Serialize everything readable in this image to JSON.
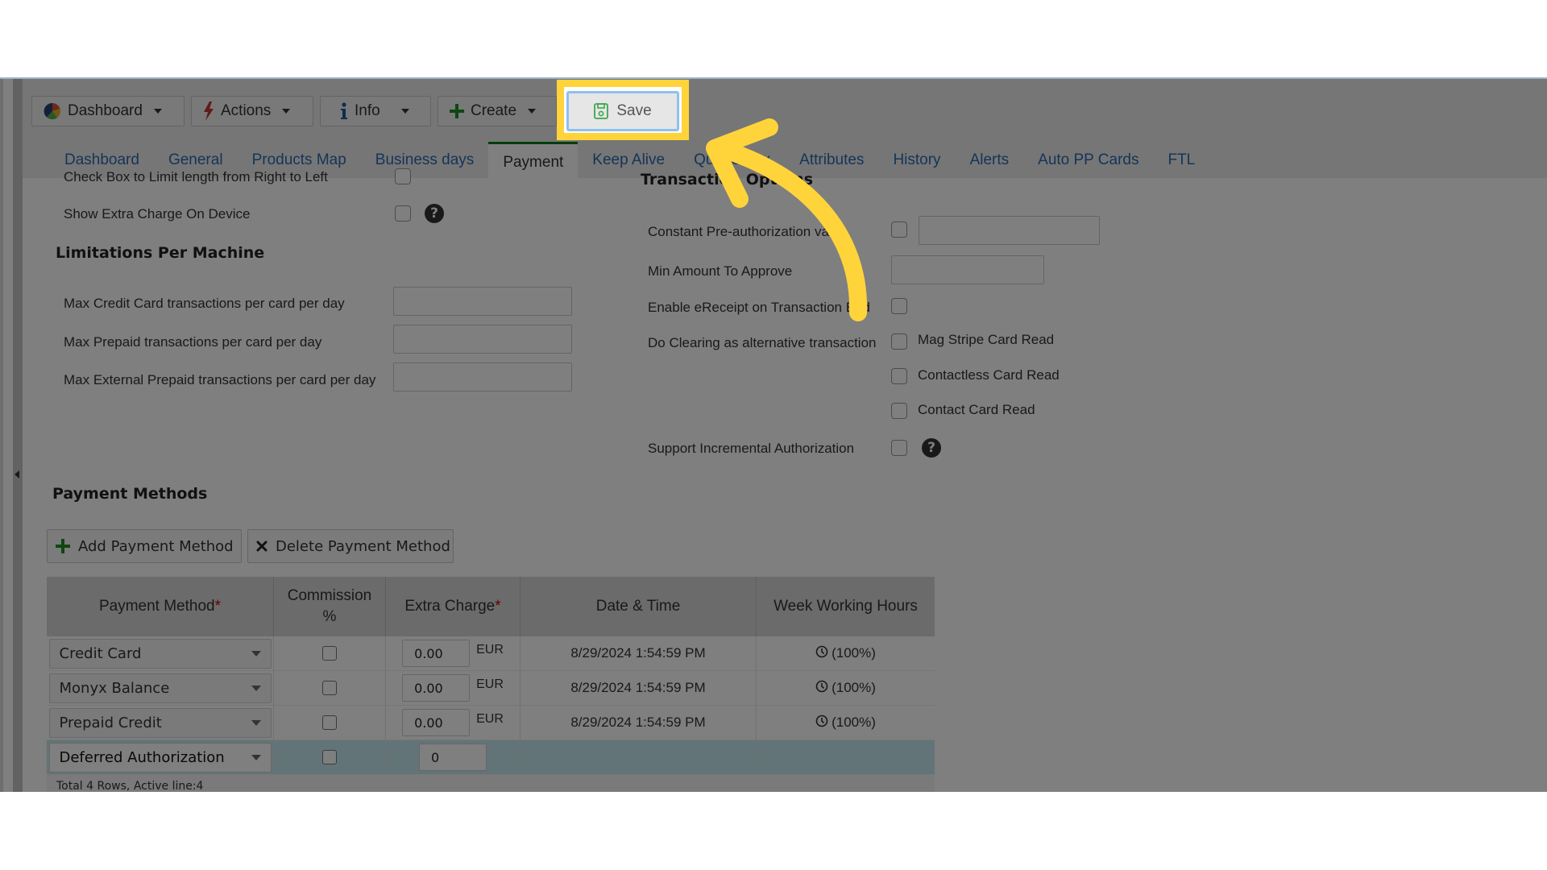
{
  "toolbar": {
    "buttons": [
      {
        "label": "Dashboard",
        "icon": "pie-chart-icon"
      },
      {
        "label": "Actions",
        "icon": "lightning-icon"
      },
      {
        "label": "Info",
        "icon": "info-icon"
      },
      {
        "label": "Create",
        "icon": "plus-icon"
      }
    ],
    "save": {
      "label": "Save",
      "icon": "floppy-disk-icon"
    }
  },
  "tabs": [
    {
      "label": "Dashboard",
      "active": false
    },
    {
      "label": "General",
      "active": false
    },
    {
      "label": "Products Map",
      "active": false
    },
    {
      "label": "Business days",
      "active": false
    },
    {
      "label": "Payment",
      "active": true
    },
    {
      "label": "Keep Alive",
      "active": false
    },
    {
      "label": "Queue Box",
      "active": false
    },
    {
      "label": "Attributes",
      "active": false
    },
    {
      "label": "History",
      "active": false
    },
    {
      "label": "Alerts",
      "active": false
    },
    {
      "label": "Auto PP Cards",
      "active": false
    },
    {
      "label": "FTL",
      "active": false
    }
  ],
  "left_form": {
    "limit_rtl_label": "Check Box to Limit length from Right to Left",
    "show_extra_charge_label": "Show Extra Charge On Device",
    "limitations_title": "Limitations Per Machine",
    "max_credit_label": "Max Credit Card transactions per card per day",
    "max_credit_value": "",
    "max_prepaid_label": "Max Prepaid transactions per card per day",
    "max_prepaid_value": "",
    "max_ext_prepaid_label": "Max External Prepaid transactions per card per day",
    "max_ext_prepaid_value": ""
  },
  "transaction_options": {
    "title": "Transaction Options",
    "const_preauth_label": "Constant Pre-authorization value",
    "const_preauth_value": "",
    "min_amount_label": "Min Amount To Approve",
    "min_amount_value": "",
    "ereceipt_label": "Enable eReceipt on Transaction End",
    "clearing_label": "Do Clearing as alternative transaction",
    "mag_stripe_label": "Mag Stripe Card Read",
    "contactless_label": "Contactless Card Read",
    "contact_label": "Contact Card Read",
    "incremental_label": "Support Incremental Authorization",
    "help_glyph": "?"
  },
  "payment_methods": {
    "title": "Payment Methods",
    "add_label": "Add Payment Method",
    "delete_label": "Delete Payment Method",
    "columns": {
      "method": "Payment Method",
      "commission_1": "Commission",
      "commission_2": "%",
      "extra_charge": "Extra Charge",
      "date_time": "Date & Time",
      "week_hours": "Week Working Hours",
      "required_mark": "*"
    },
    "rows": [
      {
        "method": "Credit Card",
        "commission": false,
        "extra_charge": "0.00",
        "currency": "EUR",
        "date_time": "8/29/2024 1:54:59 PM",
        "week_hours": "(100%)"
      },
      {
        "method": "Monyx Balance",
        "commission": false,
        "extra_charge": "0.00",
        "currency": "EUR",
        "date_time": "8/29/2024 1:54:59 PM",
        "week_hours": "(100%)"
      },
      {
        "method": "Prepaid Credit",
        "commission": false,
        "extra_charge": "0.00",
        "currency": "EUR",
        "date_time": "8/29/2024 1:54:59 PM",
        "week_hours": "(100%)"
      },
      {
        "method": "Deferred Authorization",
        "commission": false,
        "extra_charge": "0",
        "currency": "",
        "date_time": "",
        "week_hours": ""
      }
    ],
    "footer": "Total 4 Rows, Active line:4"
  },
  "annotation": {
    "highlight_color": "#ffd43b",
    "target": "Save"
  }
}
